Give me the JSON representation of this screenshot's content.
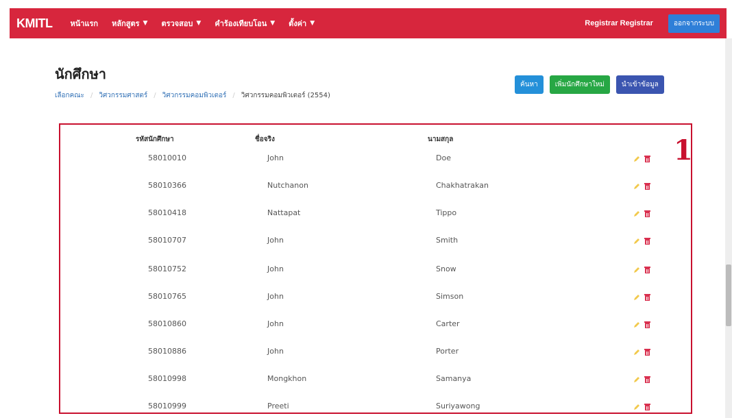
{
  "navbar": {
    "brand": "KMITL",
    "items": [
      {
        "label": "หน้าแรก",
        "dropdown": false
      },
      {
        "label": "หลักสูตร",
        "dropdown": true
      },
      {
        "label": "ตรวจสอบ",
        "dropdown": true
      },
      {
        "label": "คำร้องเทียบโอน",
        "dropdown": true
      },
      {
        "label": "ตั้งค่า",
        "dropdown": true
      }
    ],
    "user": "Registrar Registrar",
    "logout_label": "ออกจากระบบ"
  },
  "page": {
    "title": "นักศึกษา",
    "breadcrumb": [
      "เลือกคณะ",
      "วิศวกรรมศาสตร์",
      "วิศวกรรมคอมพิวเตอร์",
      "วิศวกรรมคอมพิวเตอร์ (2554)"
    ]
  },
  "actions": {
    "search_label": "ค้นหา",
    "add_label": "เพิ่มนักศึกษาใหม่",
    "import_label": "นำเข้าข้อมูล"
  },
  "table": {
    "headers": [
      "รหัสนักศึกษา",
      "ชื่อจริง",
      "นามสกุล"
    ],
    "rows": [
      {
        "id": "58010010",
        "first": "John",
        "last": "Doe"
      },
      {
        "id": "58010366",
        "first": "Nutchanon",
        "last": "Chakhatrakan"
      },
      {
        "id": "58010418",
        "first": "Nattapat",
        "last": "Tippo"
      },
      {
        "id": "58010707",
        "first": "John",
        "last": "Smith"
      },
      {
        "id": "58010752",
        "first": "John",
        "last": "Snow"
      },
      {
        "id": "58010765",
        "first": "John",
        "last": "Simson"
      },
      {
        "id": "58010860",
        "first": "John",
        "last": "Carter"
      },
      {
        "id": "58010886",
        "first": "John",
        "last": "Porter"
      },
      {
        "id": "58010998",
        "first": "Mongkhon",
        "last": "Samanya"
      },
      {
        "id": "58010999",
        "first": "Preeti",
        "last": "Suriyawong"
      }
    ]
  },
  "annotation": "1",
  "icons": {
    "edit": "pencil-icon",
    "delete": "trash-icon",
    "caret": "chevron-down-icon"
  },
  "colors": {
    "navbar": "#d7263d",
    "frame": "#c8102e",
    "edit": "#f2c94c",
    "delete": "#d9304f"
  }
}
